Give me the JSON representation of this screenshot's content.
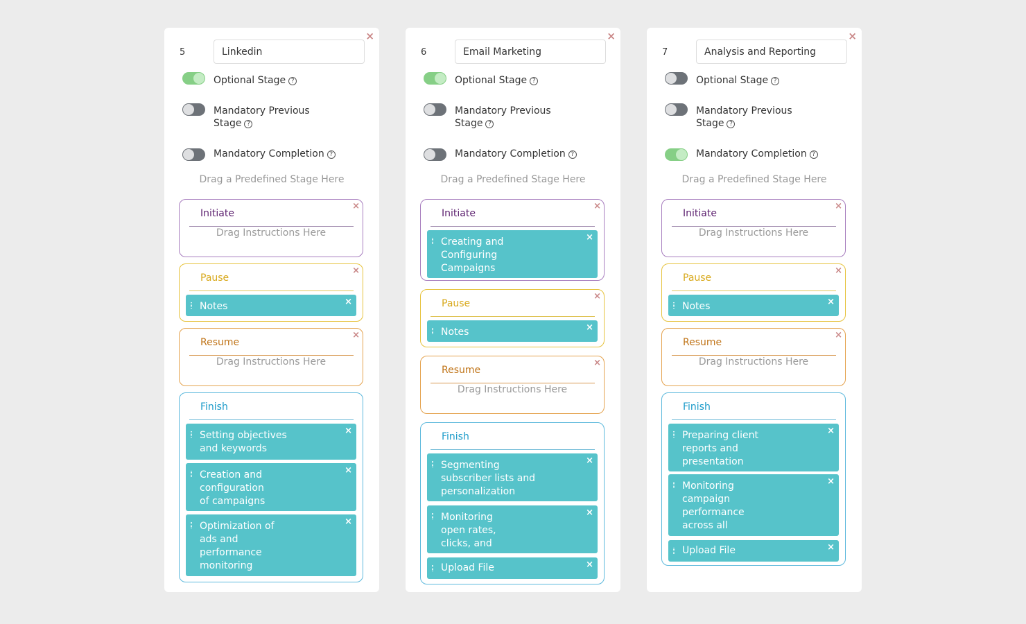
{
  "labels": {
    "optional_stage": "Optional Stage",
    "mandatory_previous_1": "Mandatory Previous",
    "mandatory_previous_2": "Stage",
    "mandatory_completion": "Mandatory Completion",
    "drag_stage": "Drag a Predefined Stage Here",
    "drag_instructions": "Drag Instructions Here",
    "help": "?",
    "close": "×"
  },
  "stage_names": {
    "initiate": "Initiate",
    "pause": "Pause",
    "resume": "Resume",
    "finish": "Finish"
  },
  "cards": [
    {
      "number": "5",
      "name": "Linkedin",
      "optional_stage": true,
      "mandatory_previous_stage": false,
      "mandatory_completion": false,
      "stages": {
        "initiate": [],
        "pause": [
          "Notes"
        ],
        "resume": [],
        "finish": [
          "Setting objectives and keywords",
          "Creation and configuration of campaigns",
          "Optimization of ads and performance monitoring"
        ]
      }
    },
    {
      "number": "6",
      "name": "Email Marketing",
      "optional_stage": true,
      "mandatory_previous_stage": false,
      "mandatory_completion": false,
      "stages": {
        "initiate": [
          "Creating and Configuring Campaigns"
        ],
        "pause": [
          "Notes"
        ],
        "resume": [],
        "finish": [
          "Segmenting subscriber lists and personalization",
          "Monitoring open rates, clicks, and",
          "Upload File"
        ]
      }
    },
    {
      "number": "7",
      "name": "Analysis and Reporting",
      "optional_stage": false,
      "mandatory_previous_stage": false,
      "mandatory_completion": true,
      "stages": {
        "initiate": [],
        "pause": [
          "Notes"
        ],
        "resume": [],
        "finish": [
          "Preparing client reports and presentation",
          "Monitoring campaign performance across all",
          "Upload File"
        ]
      }
    }
  ]
}
